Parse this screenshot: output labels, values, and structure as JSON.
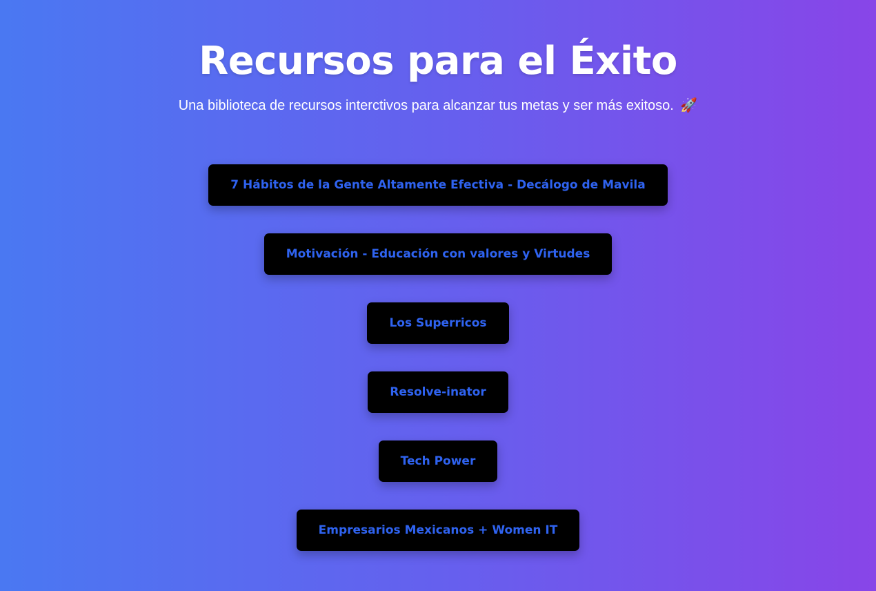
{
  "header": {
    "title": "Recursos para el Éxito",
    "subtitle": "Una biblioteca de recursos interctivos para alcanzar tus metas y ser más exitoso.",
    "subtitle_emoji": "🚀"
  },
  "resources": [
    {
      "label": "7 Hábitos de la Gente Altamente Efectiva - Decálogo de Mavila"
    },
    {
      "label": "Motivación - Educación con valores y Virtudes"
    },
    {
      "label": "Los Superricos"
    },
    {
      "label": "Resolve-inator"
    },
    {
      "label": "Tech Power"
    },
    {
      "label": "Empresarios Mexicanos + Women IT"
    }
  ],
  "colors": {
    "gradient_start": "#4a78f2",
    "gradient_end": "#8845e8",
    "button_bg": "#000000",
    "button_text": "#2f63f0"
  }
}
